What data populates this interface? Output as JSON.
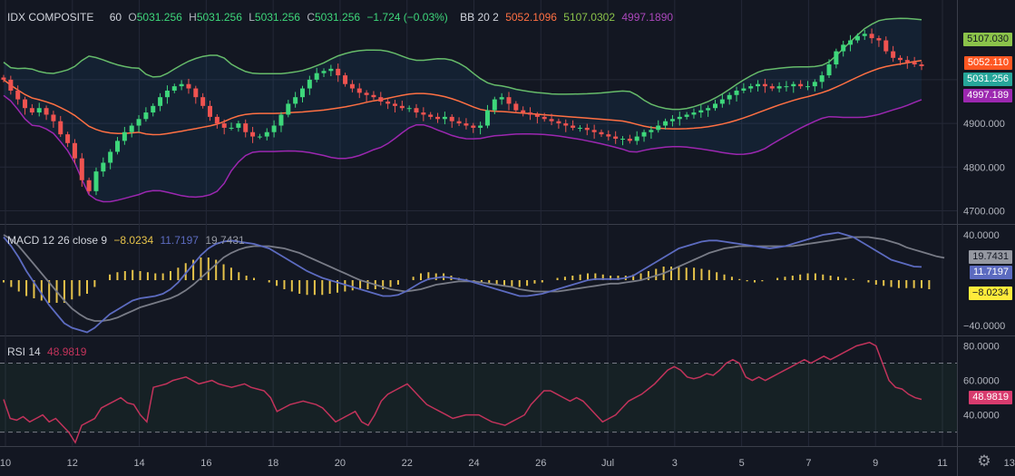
{
  "header": {
    "symbol": "IDX COMPOSITE",
    "interval": "60",
    "ohlc": {
      "o_label": "O",
      "o": "5031.256",
      "h_label": "H",
      "h": "5031.256",
      "l_label": "L",
      "l": "5031.256",
      "c_label": "C",
      "c": "5031.256",
      "change": "−1.724 (−0.03%)"
    },
    "bb_label": "BB 20 2",
    "bb_basis": "5052.1096",
    "bb_upper": "5107.0302",
    "bb_lower": "4997.1890"
  },
  "macd_legend": {
    "label": "MACD 12 26 close 9",
    "hist": "−8.0234",
    "macd": "11.7197",
    "signal": "19.7431"
  },
  "rsi_legend": {
    "label": "RSI 14",
    "value": "48.9819"
  },
  "colors": {
    "up": "#26a69a",
    "up_bright": "#3ed77b",
    "down": "#ef5350",
    "bb_upper": "#66bb6a",
    "bb_basis": "#ff7043",
    "bb_lower": "#9c27b0",
    "macd": "#5c6bc0",
    "signal": "#787b86",
    "histogram": "#e6c34a",
    "rsi": "#c2335b",
    "grid": "#242837"
  },
  "chart_data": [
    {
      "type": "candlestick",
      "pane": "price",
      "x_tick_labels": [
        "10",
        "12",
        "14",
        "16",
        "18",
        "20",
        "22",
        "24",
        "26",
        "Jul",
        "3",
        "5",
        "7",
        "9",
        "11",
        "13"
      ],
      "y_tick_labels": [
        "4700.000",
        "4800.000",
        "4900.000",
        "5000.000"
      ],
      "ylim": [
        4672,
        5172
      ],
      "price_tags": {
        "bb_upper": "5107.030",
        "bb_basis": "5052.110",
        "close": "5031.256",
        "bb_lower": "4997.189"
      },
      "close": [
        5000,
        4975,
        4955,
        4935,
        4925,
        4935,
        4920,
        4905,
        4875,
        4855,
        4820,
        4770,
        4745,
        4790,
        4810,
        4835,
        4860,
        4880,
        4895,
        4910,
        4925,
        4940,
        4960,
        4975,
        4985,
        4990,
        4980,
        4960,
        4940,
        4915,
        4900,
        4890,
        4890,
        4900,
        4880,
        4870,
        4870,
        4880,
        4895,
        4920,
        4945,
        4960,
        4980,
        5000,
        5015,
        5020,
        5025,
        5010,
        4990,
        4980,
        4970,
        4965,
        4960,
        4950,
        4945,
        4940,
        4935,
        4935,
        4925,
        4920,
        4915,
        4910,
        4915,
        4905,
        4900,
        4895,
        4890,
        4895,
        4930,
        4955,
        4960,
        4945,
        4930,
        4925,
        4920,
        4915,
        4910,
        4905,
        4900,
        4895,
        4890,
        4890,
        4885,
        4880,
        4875,
        4870,
        4865,
        4865,
        4860,
        4870,
        4880,
        4885,
        4895,
        4905,
        4910,
        4915,
        4920,
        4925,
        4930,
        4935,
        4945,
        4955,
        4965,
        4975,
        4980,
        4985,
        4990,
        4985,
        4980,
        4985,
        4985,
        4990,
        4985,
        4985,
        4995,
        5010,
        5035,
        5065,
        5080,
        5090,
        5100,
        5105,
        5095,
        5090,
        5065,
        5050,
        5045,
        5040,
        5035,
        5031
      ]
    },
    {
      "type": "line",
      "pane": "macd",
      "series": [
        {
          "name": "MACD",
          "values": [
            38,
            30,
            20,
            8,
            -2,
            -12,
            -22,
            -30,
            -38,
            -42,
            -44,
            -46,
            -42,
            -36,
            -30,
            -26,
            -22,
            -18,
            -16,
            -15,
            -14,
            -12,
            -8,
            -2,
            6,
            14,
            22,
            28,
            32,
            34,
            35,
            34,
            33,
            32,
            30,
            28,
            24,
            20,
            16,
            12,
            8,
            5,
            2,
            0,
            -2,
            -4,
            -6,
            -8,
            -10,
            -12,
            -14,
            -14,
            -13,
            -10,
            -6,
            -2,
            1,
            2,
            3,
            2,
            1,
            0,
            -2,
            -4,
            -6,
            -8,
            -10,
            -12,
            -14,
            -14,
            -13,
            -12,
            -10,
            -8,
            -6,
            -4,
            -2,
            0,
            1,
            1,
            1,
            1,
            2,
            4,
            8,
            12,
            16,
            20,
            24,
            28,
            30,
            32,
            34,
            35,
            35,
            34,
            33,
            32,
            31,
            30,
            29,
            28,
            29,
            30,
            32,
            34,
            36,
            38,
            40,
            41,
            42,
            40,
            38,
            34,
            30,
            26,
            22,
            18,
            16,
            14,
            12,
            11.7
          ]
        },
        {
          "name": "Signal",
          "values": [
            40,
            36,
            30,
            22,
            14,
            6,
            -2,
            -10,
            -18,
            -25,
            -30,
            -34,
            -36,
            -36,
            -35,
            -33,
            -30,
            -27,
            -24,
            -22,
            -20,
            -18,
            -16,
            -13,
            -9,
            -4,
            2,
            8,
            14,
            20,
            24,
            27,
            29,
            30,
            30,
            30,
            29,
            28,
            26,
            24,
            21,
            18,
            15,
            12,
            9,
            6,
            3,
            0,
            -2,
            -4,
            -6,
            -8,
            -9,
            -10,
            -9,
            -8,
            -6,
            -4,
            -3,
            -2,
            -1,
            -1,
            -1,
            -2,
            -3,
            -4,
            -5,
            -6,
            -8,
            -9,
            -10,
            -10,
            -10,
            -10,
            -9,
            -8,
            -7,
            -6,
            -5,
            -4,
            -3,
            -3,
            -2,
            -1,
            0,
            2,
            4,
            6,
            9,
            12,
            15,
            18,
            21,
            24,
            26,
            28,
            29,
            30,
            30,
            30,
            30,
            30,
            30,
            30,
            30,
            31,
            32,
            33,
            34,
            35,
            36,
            37,
            38,
            38,
            38,
            37,
            36,
            34,
            32,
            29,
            27,
            25,
            23,
            21,
            19.7
          ]
        },
        {
          "name": "Histogram",
          "values": [
            -2,
            -6,
            -10,
            -14,
            -16,
            -18,
            -20,
            -20,
            -20,
            -17,
            -14,
            -12,
            -6,
            0,
            5,
            7,
            8,
            9,
            8,
            7,
            6,
            6,
            8,
            11,
            15,
            18,
            20,
            20,
            18,
            14,
            11,
            7,
            4,
            2,
            0,
            -2,
            -5,
            -8,
            -10,
            -12,
            -13,
            -13,
            -13,
            -12,
            -11,
            -10,
            -9,
            -8,
            -8,
            -8,
            -8,
            -6,
            -4,
            0,
            3,
            6,
            7,
            6,
            6,
            4,
            2,
            1,
            -1,
            -2,
            -3,
            -4,
            -5,
            -6,
            -6,
            -5,
            -3,
            -2,
            0,
            2,
            3,
            4,
            5,
            6,
            6,
            5,
            4,
            4,
            4,
            5,
            6,
            8,
            10,
            12,
            12,
            12,
            11,
            11,
            10,
            9,
            7,
            5,
            3,
            1,
            -1,
            -2,
            -1,
            0,
            2,
            3,
            4,
            5,
            6,
            6,
            5,
            4,
            3,
            2,
            1,
            0,
            -2,
            -4,
            -5,
            -6,
            -7,
            -7,
            -7,
            -7,
            -8
          ]
        }
      ],
      "y_tick_labels": [
        "40.0000",
        "−40.0000"
      ],
      "ylim": [
        -48,
        48
      ],
      "value_tags": {
        "signal": "19.7431",
        "macd": "11.7197",
        "histogram": "−8.0234"
      }
    },
    {
      "type": "line",
      "pane": "rsi",
      "series": [
        {
          "name": "RSI",
          "values": [
            49,
            38,
            37,
            39,
            36,
            38,
            40,
            36,
            38,
            34,
            30,
            24,
            34,
            36,
            38,
            44,
            46,
            48,
            50,
            47,
            46,
            40,
            36,
            56,
            57,
            58,
            60,
            61,
            62,
            60,
            58,
            59,
            60,
            58,
            57,
            56,
            57,
            58,
            56,
            55,
            54,
            50,
            42,
            44,
            46,
            47,
            48,
            47,
            46,
            44,
            40,
            36,
            38,
            40,
            42,
            36,
            34,
            40,
            48,
            52,
            54,
            56,
            58,
            54,
            50,
            46,
            44,
            42,
            40,
            38,
            39,
            40,
            40,
            40,
            38,
            36,
            35,
            34,
            36,
            38,
            40,
            46,
            50,
            54,
            54,
            52,
            50,
            48,
            50,
            48,
            44,
            40,
            36,
            38,
            40,
            44,
            48,
            50,
            52,
            55,
            58,
            62,
            66,
            68,
            66,
            62,
            61,
            62,
            64,
            63,
            66,
            70,
            72,
            70,
            62,
            60,
            62,
            60,
            62,
            64,
            66,
            68,
            70,
            72,
            70,
            72,
            74,
            72,
            74,
            76,
            78,
            80,
            81,
            82,
            80,
            70,
            60,
            56,
            55,
            52,
            50,
            49
          ]
        }
      ],
      "y_tick_labels": [
        "80.0000",
        "60.0000",
        "40.0000"
      ],
      "ylim": [
        23,
        85
      ],
      "bands": [
        30,
        70
      ],
      "value_tag": "48.9819"
    }
  ]
}
